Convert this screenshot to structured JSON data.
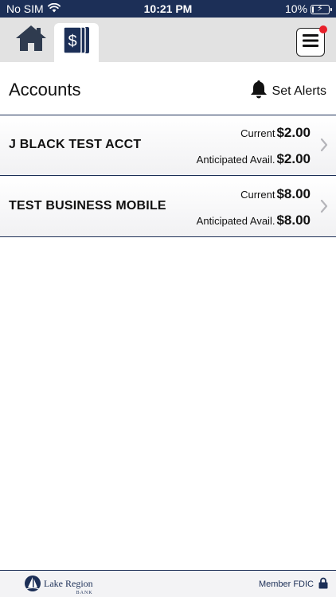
{
  "status_bar": {
    "carrier": "No SIM",
    "time": "10:21 PM",
    "battery_percent": "10%",
    "battery_level": 0.1
  },
  "nav": {
    "home_icon": "home-icon",
    "accounts_icon": "accounts-dollar-icon",
    "menu_icon": "hamburger-menu-icon",
    "has_notification": true
  },
  "header": {
    "title": "Accounts",
    "alerts_label": "Set Alerts"
  },
  "accounts": [
    {
      "name": "J BLACK TEST ACCT",
      "current_label": "Current",
      "current_value": "$2.00",
      "avail_label": "Anticipated Avail.",
      "avail_value": "$2.00"
    },
    {
      "name": "TEST BUSINESS MOBILE",
      "current_label": "Current",
      "current_value": "$8.00",
      "avail_label": "Anticipated Avail.",
      "avail_value": "$8.00"
    }
  ],
  "footer": {
    "bank_name": "Lake Region",
    "bank_sub": "BANK",
    "fdic_text": "Member FDIC"
  },
  "colors": {
    "brand_navy": "#1c2f57",
    "notification_red": "#e8202a",
    "nav_gray": "#e2e2e2"
  }
}
